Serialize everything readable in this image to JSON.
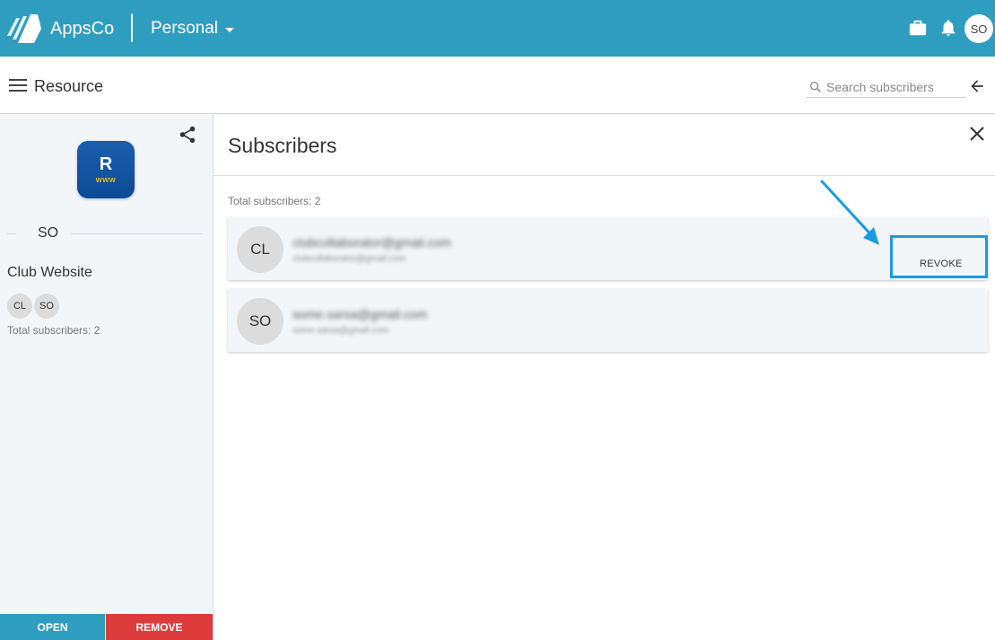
{
  "header": {
    "brand": "AppsCo",
    "workspace": "Personal",
    "user_initials": "SO"
  },
  "toolbar": {
    "title": "Resource",
    "search_placeholder": "Search subscribers"
  },
  "resource": {
    "icon_letter": "R",
    "icon_subtext": "www",
    "owner": "SO",
    "name": "Club Website",
    "subscriber_initials": [
      "CL",
      "SO"
    ],
    "total_subscribers": "Total subscribers: 2",
    "open_label": "OPEN",
    "remove_label": "REMOVE"
  },
  "subscribers_panel": {
    "title": "Subscribers",
    "total": "Total subscribers: 2",
    "items": [
      {
        "initials": "CL",
        "email": "clubcollaborator@gmail.com",
        "email_secondary": "clubcollaborator@gmail.com",
        "action": "REVOKE"
      },
      {
        "initials": "SO",
        "email": "some.sarsa@gmail.com",
        "email_secondary": "some.sarsa@gmail.com"
      }
    ]
  },
  "colors": {
    "header_bg": "#2e9dc0",
    "open_button": "#2e9dc0",
    "remove_button": "#de3c3c",
    "annotation": "#1a9be6"
  },
  "icons": [
    "logo-icon",
    "briefcase-icon",
    "bell-icon",
    "menu-icon",
    "search-icon",
    "back-arrow-icon",
    "share-icon",
    "close-icon"
  ]
}
